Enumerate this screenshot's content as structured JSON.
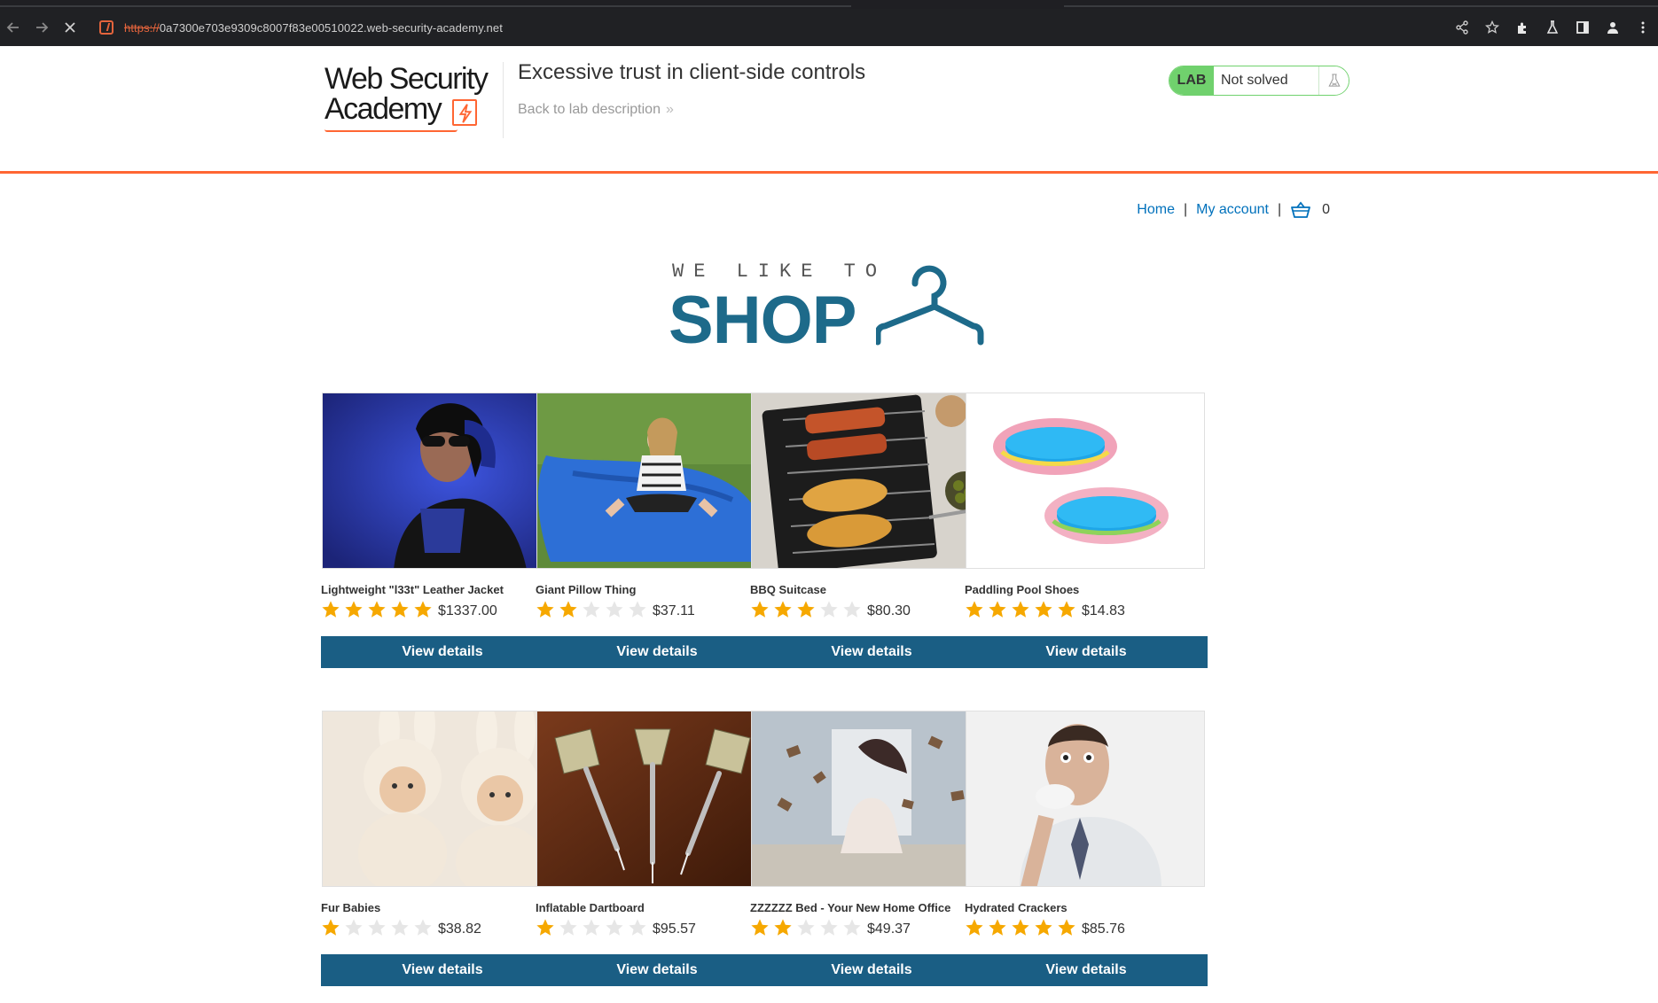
{
  "browser": {
    "url_scheme": "https://",
    "url_rest": "0a7300e703e9309c8007f83e00510022.web-security-academy.net"
  },
  "header": {
    "logo_line1": "Web Security",
    "logo_line2": "Academy",
    "lab_title": "Excessive trust in client-side controls",
    "back_link": "Back to lab description",
    "lab_badge": "LAB",
    "lab_state": "Not solved",
    "accent_color": "#ff6633",
    "status_color": "#70d16d"
  },
  "nav": {
    "home": "Home",
    "account": "My account",
    "cart_count": "0"
  },
  "banner": {
    "top": "WE LIKE TO",
    "main": "SHOP"
  },
  "products": [
    {
      "name": "Lightweight \"l33t\" Leather Jacket",
      "price": "$1337.00",
      "rating": 5,
      "button": "View details"
    },
    {
      "name": "Giant Pillow Thing",
      "price": "$37.11",
      "rating": 2,
      "button": "View details"
    },
    {
      "name": "BBQ Suitcase",
      "price": "$80.30",
      "rating": 3,
      "button": "View details"
    },
    {
      "name": "Paddling Pool Shoes",
      "price": "$14.83",
      "rating": 5,
      "button": "View details"
    },
    {
      "name": "Fur Babies",
      "price": "$38.82",
      "rating": 1,
      "button": "View details"
    },
    {
      "name": "Inflatable Dartboard",
      "price": "$95.57",
      "rating": 1,
      "button": "View details"
    },
    {
      "name": "ZZZZZZ Bed - Your New Home Office",
      "price": "$49.37",
      "rating": 2,
      "button": "View details"
    },
    {
      "name": "Hydrated Crackers",
      "price": "$85.76",
      "rating": 5,
      "button": "View details"
    }
  ]
}
